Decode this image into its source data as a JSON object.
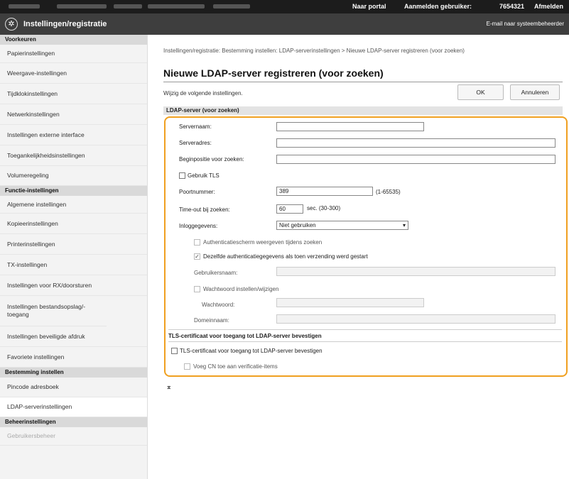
{
  "topbar": {
    "portal_link": "Naar portal",
    "login_user": "Aanmelden gebruiker:",
    "user_id": "7654321",
    "logout": "Afmelden"
  },
  "header": {
    "title": "Instellingen/registratie",
    "mail_admin": "E-mail naar systeembeheerder"
  },
  "sidebar": {
    "sections": [
      {
        "title": "Voorkeuren",
        "items": [
          "Papierinstellingen",
          "Weergave-instellingen",
          "Tijdklokinstellingen",
          "Netwerkinstellingen",
          "Instellingen externe interface",
          "Toegankelijkheidsinstellingen",
          "Volumeregeling"
        ]
      },
      {
        "title": "Functie-instellingen",
        "items": [
          "Algemene instellingen",
          "Kopieerinstellingen",
          "Printerinstellingen",
          "TX-instellingen",
          "Instellingen voor RX/doorsturen",
          "Instellingen bestandsopslag/-toegang",
          "Instellingen beveiligde afdruk",
          "Favoriete instellingen"
        ]
      },
      {
        "title": "Bestemming instellen",
        "items": [
          "Pincode adresboek",
          "LDAP-serverinstellingen"
        ]
      },
      {
        "title": "Beheerinstellingen",
        "items": [
          "Gebruikersbeheer"
        ]
      }
    ]
  },
  "main": {
    "breadcrumb": "Instellingen/registratie: Bestemming instellen: LDAP-serverinstellingen > Nieuwe LDAP-server registreren (voor zoeken)",
    "title": "Nieuwe LDAP-server registreren (voor zoeken)",
    "description": "Wijzig de volgende instellingen.",
    "ok_label": "OK",
    "cancel_label": "Annuleren",
    "section1": "LDAP-server (voor zoeken)",
    "server_name_label": "Servernaam:",
    "server_address_label": "Serveradres:",
    "start_search_label": "Beginpositie voor zoeken:",
    "use_tls_label": "Gebruik TLS",
    "port_label": "Poortnummer:",
    "port_value": "389",
    "port_range": "(1-65535)",
    "timeout_label": "Time-out bij zoeken:",
    "timeout_value": "60",
    "timeout_unit": "sec. (30-300)",
    "login_info_label": "Inloggegevens:",
    "login_info_value": "Niet gebruiken",
    "show_auth_label": "Authenticatiescherm weergeven tijdens zoeken",
    "same_auth_label": "Dezelfde authenticatiegegevens als toen verzending werd gestart",
    "username_label": "Gebruikersnaam:",
    "set_password_label": "Wachtwoord instellen/wijzigen",
    "password_label": "Wachtwoord:",
    "domain_label": "Domeinnaam:",
    "section2": "TLS-certificaat voor toegang tot LDAP-server bevestigen",
    "verify_cert_label": "TLS-certificaat voor toegang tot LDAP-server bevestigen",
    "add_cn_label": "Voeg CN toe aan verificatie-items",
    "to_top": "⌅"
  }
}
